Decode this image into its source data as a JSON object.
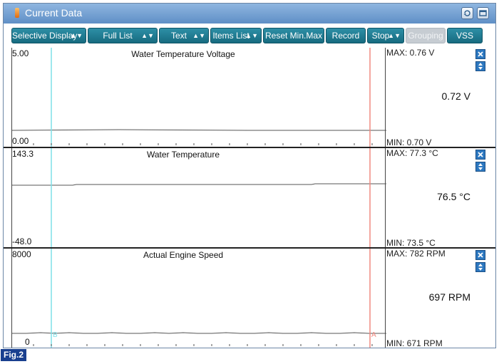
{
  "window": {
    "title": "Current Data"
  },
  "icons": {
    "title_glyph": "app-indicator-icon",
    "refresh": "refresh-icon",
    "window": "window-toggle-icon"
  },
  "toolbar": [
    {
      "label": "Selective Display",
      "spin": true,
      "enabled": true
    },
    {
      "label": "Full List",
      "spin": true,
      "enabled": true
    },
    {
      "label": "Text",
      "spin": true,
      "enabled": true
    },
    {
      "label": "Items List",
      "spin": true,
      "enabled": true
    },
    {
      "label": "Reset Min.Max",
      "spin": false,
      "enabled": true
    },
    {
      "label": "Record",
      "spin": false,
      "enabled": true
    },
    {
      "label": "Stop",
      "spin": true,
      "enabled": true
    },
    {
      "label": "Grouping",
      "spin": false,
      "enabled": false
    },
    {
      "label": "VSS",
      "spin": false,
      "enabled": true
    }
  ],
  "panels": [
    {
      "title": "Water Temperature Voltage",
      "scale_max": "5.00",
      "scale_min": "0.00",
      "max_text": "MAX:  0.76 V",
      "min_text": "MIN:  0.70 V",
      "current": "0.72 V"
    },
    {
      "title": "Water Temperature",
      "scale_max": "143.3",
      "scale_min": "-48.0",
      "max_text": "MAX:  77.3 °C",
      "min_text": "MIN:  73.5 °C",
      "current": "76.5 °C"
    },
    {
      "title": "Actual Engine Speed",
      "scale_max": "8000",
      "scale_min": "0",
      "max_text": "MAX:    782 RPM",
      "min_text": "MIN:   671 RPM",
      "current": "697 RPM"
    }
  ],
  "cursors": {
    "left_label": "B",
    "right_label": "A"
  },
  "colors": {
    "titlebar": "#6f9bd1",
    "button": "#1f7a90",
    "cursor_left": "#7fe0e8",
    "cursor_right": "#f08a80",
    "close_button": "#2d78c0"
  },
  "figure_label": "Fig.2"
}
